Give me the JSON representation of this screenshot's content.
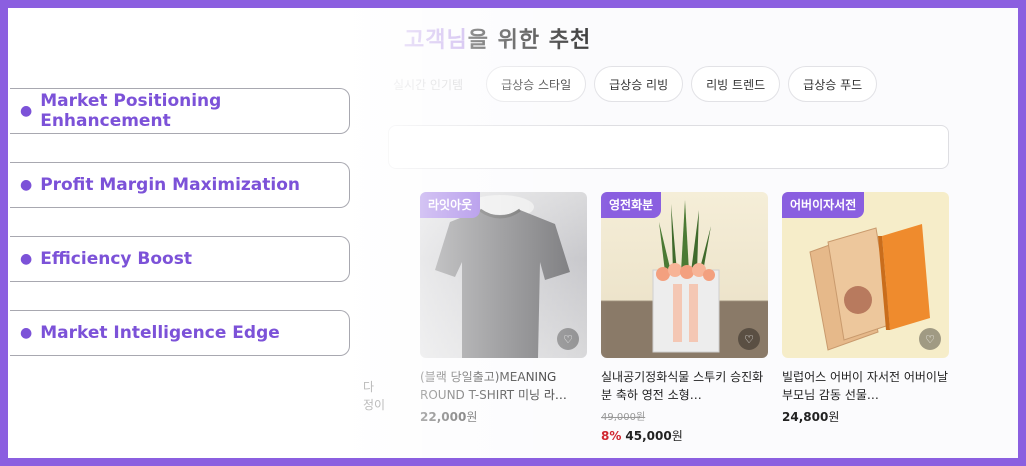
{
  "section": {
    "title_accent": "고객님",
    "title_rest": "을 위한 추천"
  },
  "chips": [
    "실시간 인기템",
    "급상승 스타일",
    "급상승 리빙",
    "리빙 트렌드",
    "급상승 푸드"
  ],
  "features": [
    "Market Positioning Enhancement",
    "Profit Margin Maximization",
    "Efficiency Boost",
    "Market Intelligence Edge"
  ],
  "partial_text": [
    "다",
    "정이"
  ],
  "products": [
    {
      "badge": "라잇아웃",
      "name": "(블랙 당일출고)MEANING ROUND T-SHIRT 미닝 라…",
      "original": "",
      "discount": "",
      "price": "22,000",
      "won": "원"
    },
    {
      "badge": "영전화분",
      "name": "실내공기정화식물 스투키 승진화분 축하 영전 소형…",
      "original": "49,000원",
      "discount": "8%",
      "price": "45,000",
      "won": "원"
    },
    {
      "badge": "어버이자서전",
      "name": "빌럽어스 어버이 자서전 어버이날 부모님 감동 선물…",
      "original": "",
      "discount": "",
      "price": "24,800",
      "won": "원"
    }
  ],
  "colors": {
    "accent": "#8a5fe0",
    "border": "#8b5fe0",
    "discount": "#d0262f"
  }
}
